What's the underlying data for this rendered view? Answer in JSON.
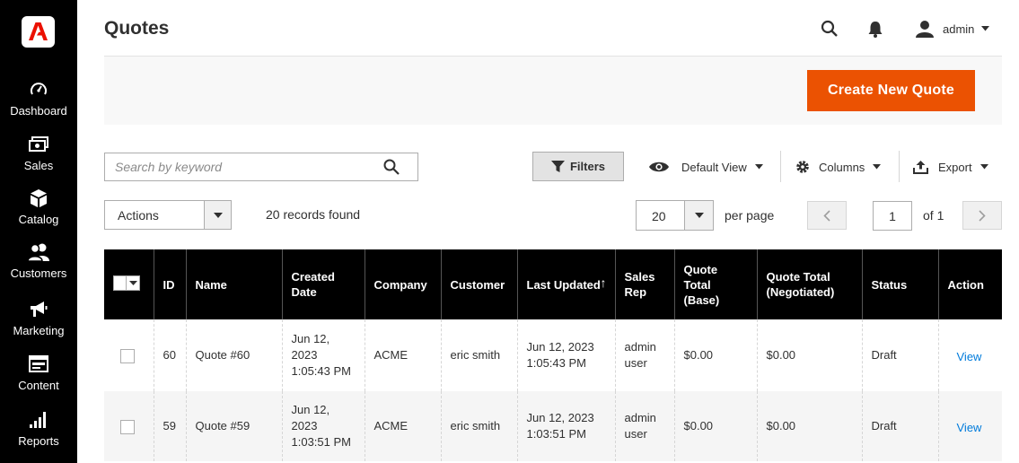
{
  "sidebar": {
    "items": [
      {
        "label": "Dashboard",
        "icon": "dashboard-icon"
      },
      {
        "label": "Sales",
        "icon": "sales-icon"
      },
      {
        "label": "Catalog",
        "icon": "catalog-icon"
      },
      {
        "label": "Customers",
        "icon": "customers-icon"
      },
      {
        "label": "Marketing",
        "icon": "marketing-icon"
      },
      {
        "label": "Content",
        "icon": "content-icon"
      },
      {
        "label": "Reports",
        "icon": "reports-icon"
      }
    ]
  },
  "header": {
    "title": "Quotes",
    "user": "admin"
  },
  "action_bar": {
    "create_label": "Create New Quote"
  },
  "toolbar": {
    "search_placeholder": "Search by keyword",
    "filters_label": "Filters",
    "view_label": "Default View",
    "columns_label": "Columns",
    "export_label": "Export",
    "actions_label": "Actions",
    "records_found": "20 records found",
    "per_page_value": "20",
    "per_page_label": "per page",
    "page_value": "1",
    "page_of": "of 1"
  },
  "grid": {
    "columns": [
      "ID",
      "Name",
      "Created Date",
      "Company",
      "Customer",
      "Last Updated",
      "Sales Rep",
      "Quote Total (Base)",
      "Quote Total (Negotiated)",
      "Status",
      "Action"
    ],
    "sort_indicator": "↑",
    "rows": [
      {
        "id": "60",
        "name": "Quote #60",
        "created": "Jun 12, 2023 1:05:43 PM",
        "company": "ACME",
        "customer": "eric smith",
        "updated": "Jun 12, 2023 1:05:43 PM",
        "rep": "admin user",
        "total_base": "$0.00",
        "total_neg": "$0.00",
        "status": "Draft",
        "action": "View"
      },
      {
        "id": "59",
        "name": "Quote #59",
        "created": "Jun 12, 2023 1:03:51 PM",
        "company": "ACME",
        "customer": "eric smith",
        "updated": "Jun 12, 2023 1:03:51 PM",
        "rep": "admin user",
        "total_base": "$0.00",
        "total_neg": "$0.00",
        "status": "Draft",
        "action": "View"
      }
    ]
  },
  "colors": {
    "sidebar_bg": "#000000",
    "accent": "#eb5202",
    "link": "#007bdb",
    "logo_red": "#eb1000"
  }
}
